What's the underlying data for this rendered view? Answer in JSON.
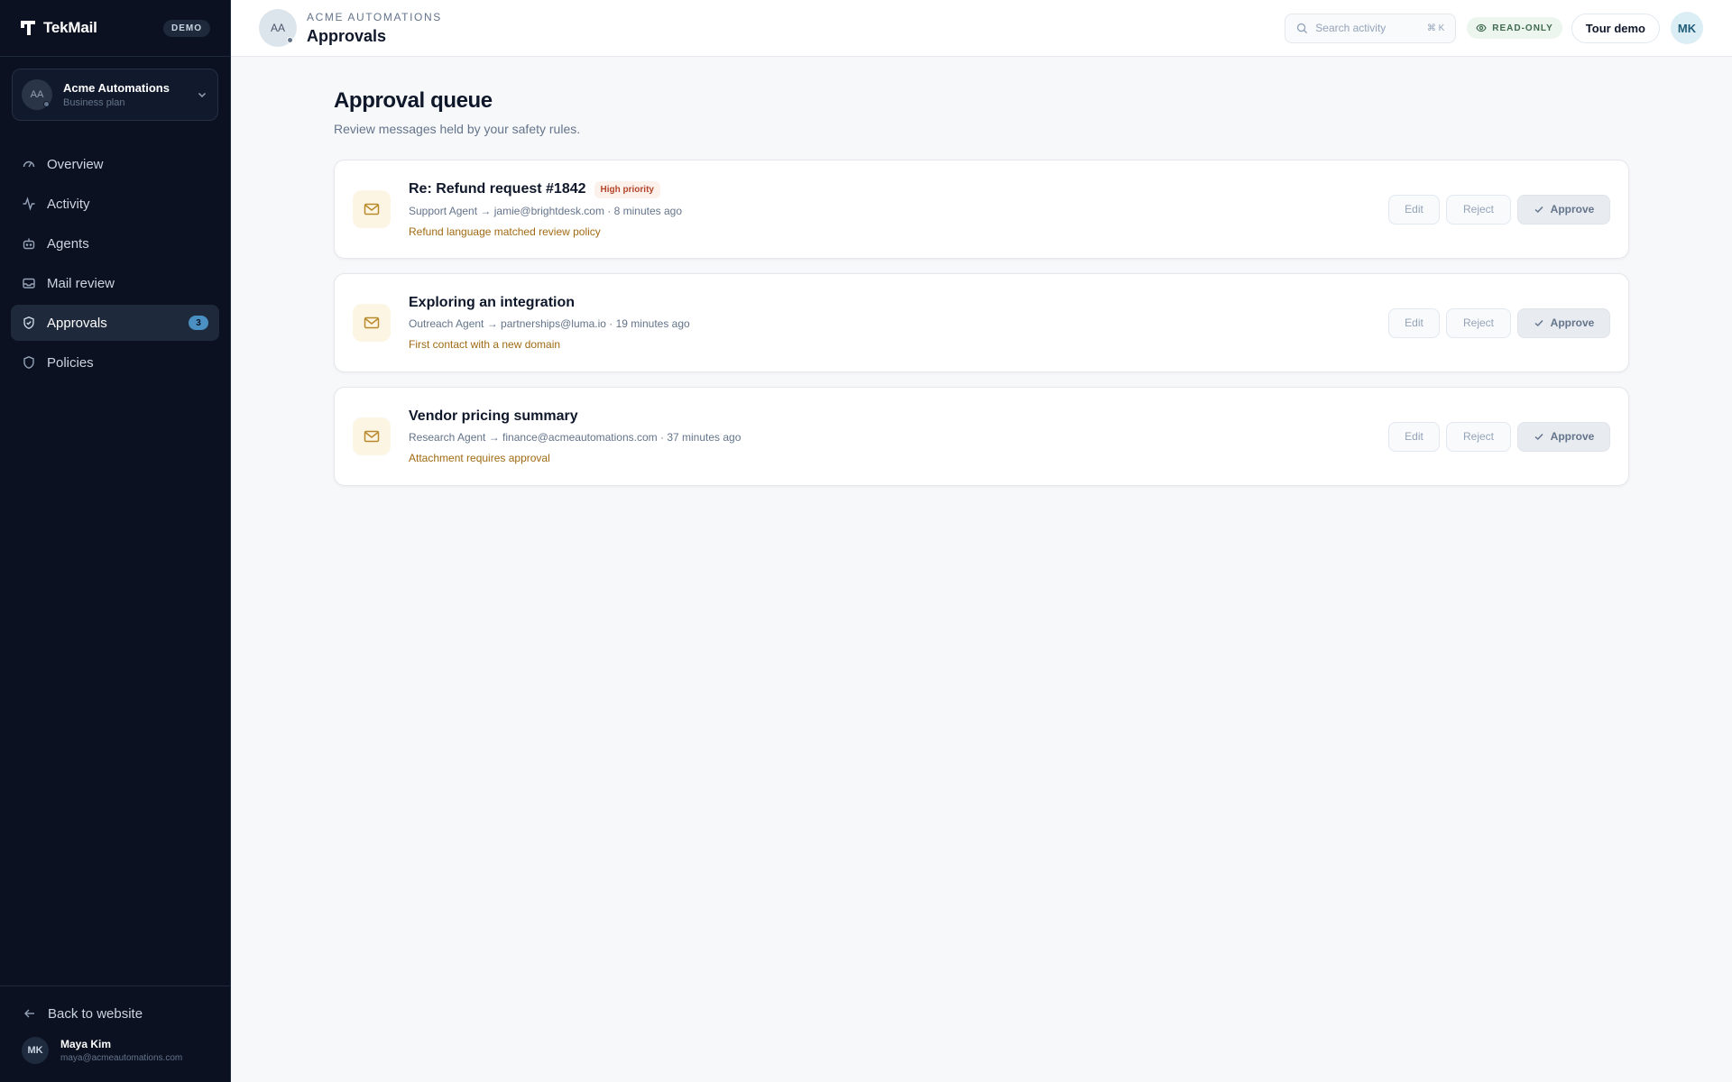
{
  "sidebar": {
    "brand_name": "TekMail",
    "demo_badge": "DEMO",
    "workspace": {
      "initials": "AA",
      "name": "Acme Automations",
      "plan": "Business plan"
    },
    "nav": [
      {
        "label": "Overview",
        "icon": "gauge-icon"
      },
      {
        "label": "Activity",
        "icon": "activity-icon"
      },
      {
        "label": "Agents",
        "icon": "bot-icon"
      },
      {
        "label": "Mail review",
        "icon": "inbox-icon"
      },
      {
        "label": "Approvals",
        "icon": "shield-check-icon",
        "count": "3",
        "active": true
      },
      {
        "label": "Policies",
        "icon": "shield-icon"
      }
    ],
    "back_link": "Back to website",
    "user": {
      "initials": "MK",
      "name": "Maya Kim",
      "email": "maya@acmeautomations.com"
    }
  },
  "topbar": {
    "org_initials": "AA",
    "org_name": "ACME AUTOMATIONS",
    "page_title": "Approvals",
    "search_placeholder": "Search activity",
    "search_shortcut": "⌘ K",
    "readonly_label": "READ-ONLY",
    "tour_button": "Tour demo",
    "user_initials": "MK"
  },
  "main": {
    "title": "Approval queue",
    "subtitle": "Review messages held by your safety rules.",
    "buttons": {
      "edit": "Edit",
      "reject": "Reject",
      "approve": "Approve"
    },
    "items": [
      {
        "subject": "Re: Refund request #1842",
        "badge": "High priority",
        "meta": "Support Agent → jamie@brightdesk.com · 8 minutes ago",
        "reason": "Refund language matched review policy"
      },
      {
        "subject": "Exploring an integration",
        "badge": "",
        "meta": "Outreach Agent → partnerships@luma.io · 19 minutes ago",
        "reason": "First contact with a new domain"
      },
      {
        "subject": "Vendor pricing summary",
        "badge": "",
        "meta": "Research Agent → finance@acmeautomations.com · 37 minutes ago",
        "reason": "Attachment requires approval"
      }
    ]
  },
  "colors": {
    "sidebar_bg": "#0b1120",
    "accent_count": "#4a90c2",
    "reason_text": "#a06a12",
    "priority_text": "#b4452a",
    "readonly_bg": "#ecf5ee"
  }
}
